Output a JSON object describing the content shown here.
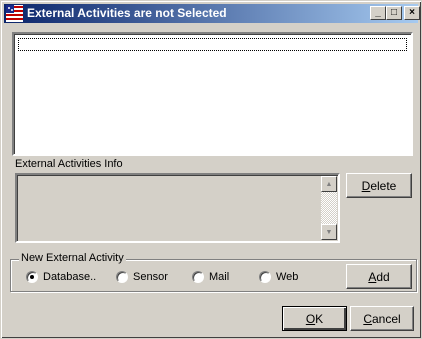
{
  "window": {
    "title": "External Activities are not Selected",
    "controls": {
      "minimize": "_",
      "maximize": "□",
      "close": "×"
    }
  },
  "activities_list": {
    "items": []
  },
  "info": {
    "label": "External Activities Info",
    "text": ""
  },
  "buttons": {
    "delete_prefix": "",
    "delete_accel": "D",
    "delete_rest": "elete",
    "add_prefix": "",
    "add_accel": "A",
    "add_rest": "dd",
    "ok_prefix": "",
    "ok_accel": "O",
    "ok_rest": "K",
    "cancel_prefix": "",
    "cancel_accel": "C",
    "cancel_rest": "ancel"
  },
  "new_activity": {
    "label": "New External Activity",
    "options": [
      {
        "label": "Database..",
        "selected": true
      },
      {
        "label": "Sensor",
        "selected": false
      },
      {
        "label": "Mail",
        "selected": false
      },
      {
        "label": "Web",
        "selected": false
      }
    ]
  },
  "colors": {
    "face": "#d4d0c8",
    "title_start": "#0a246a",
    "title_end": "#a6caf0"
  }
}
